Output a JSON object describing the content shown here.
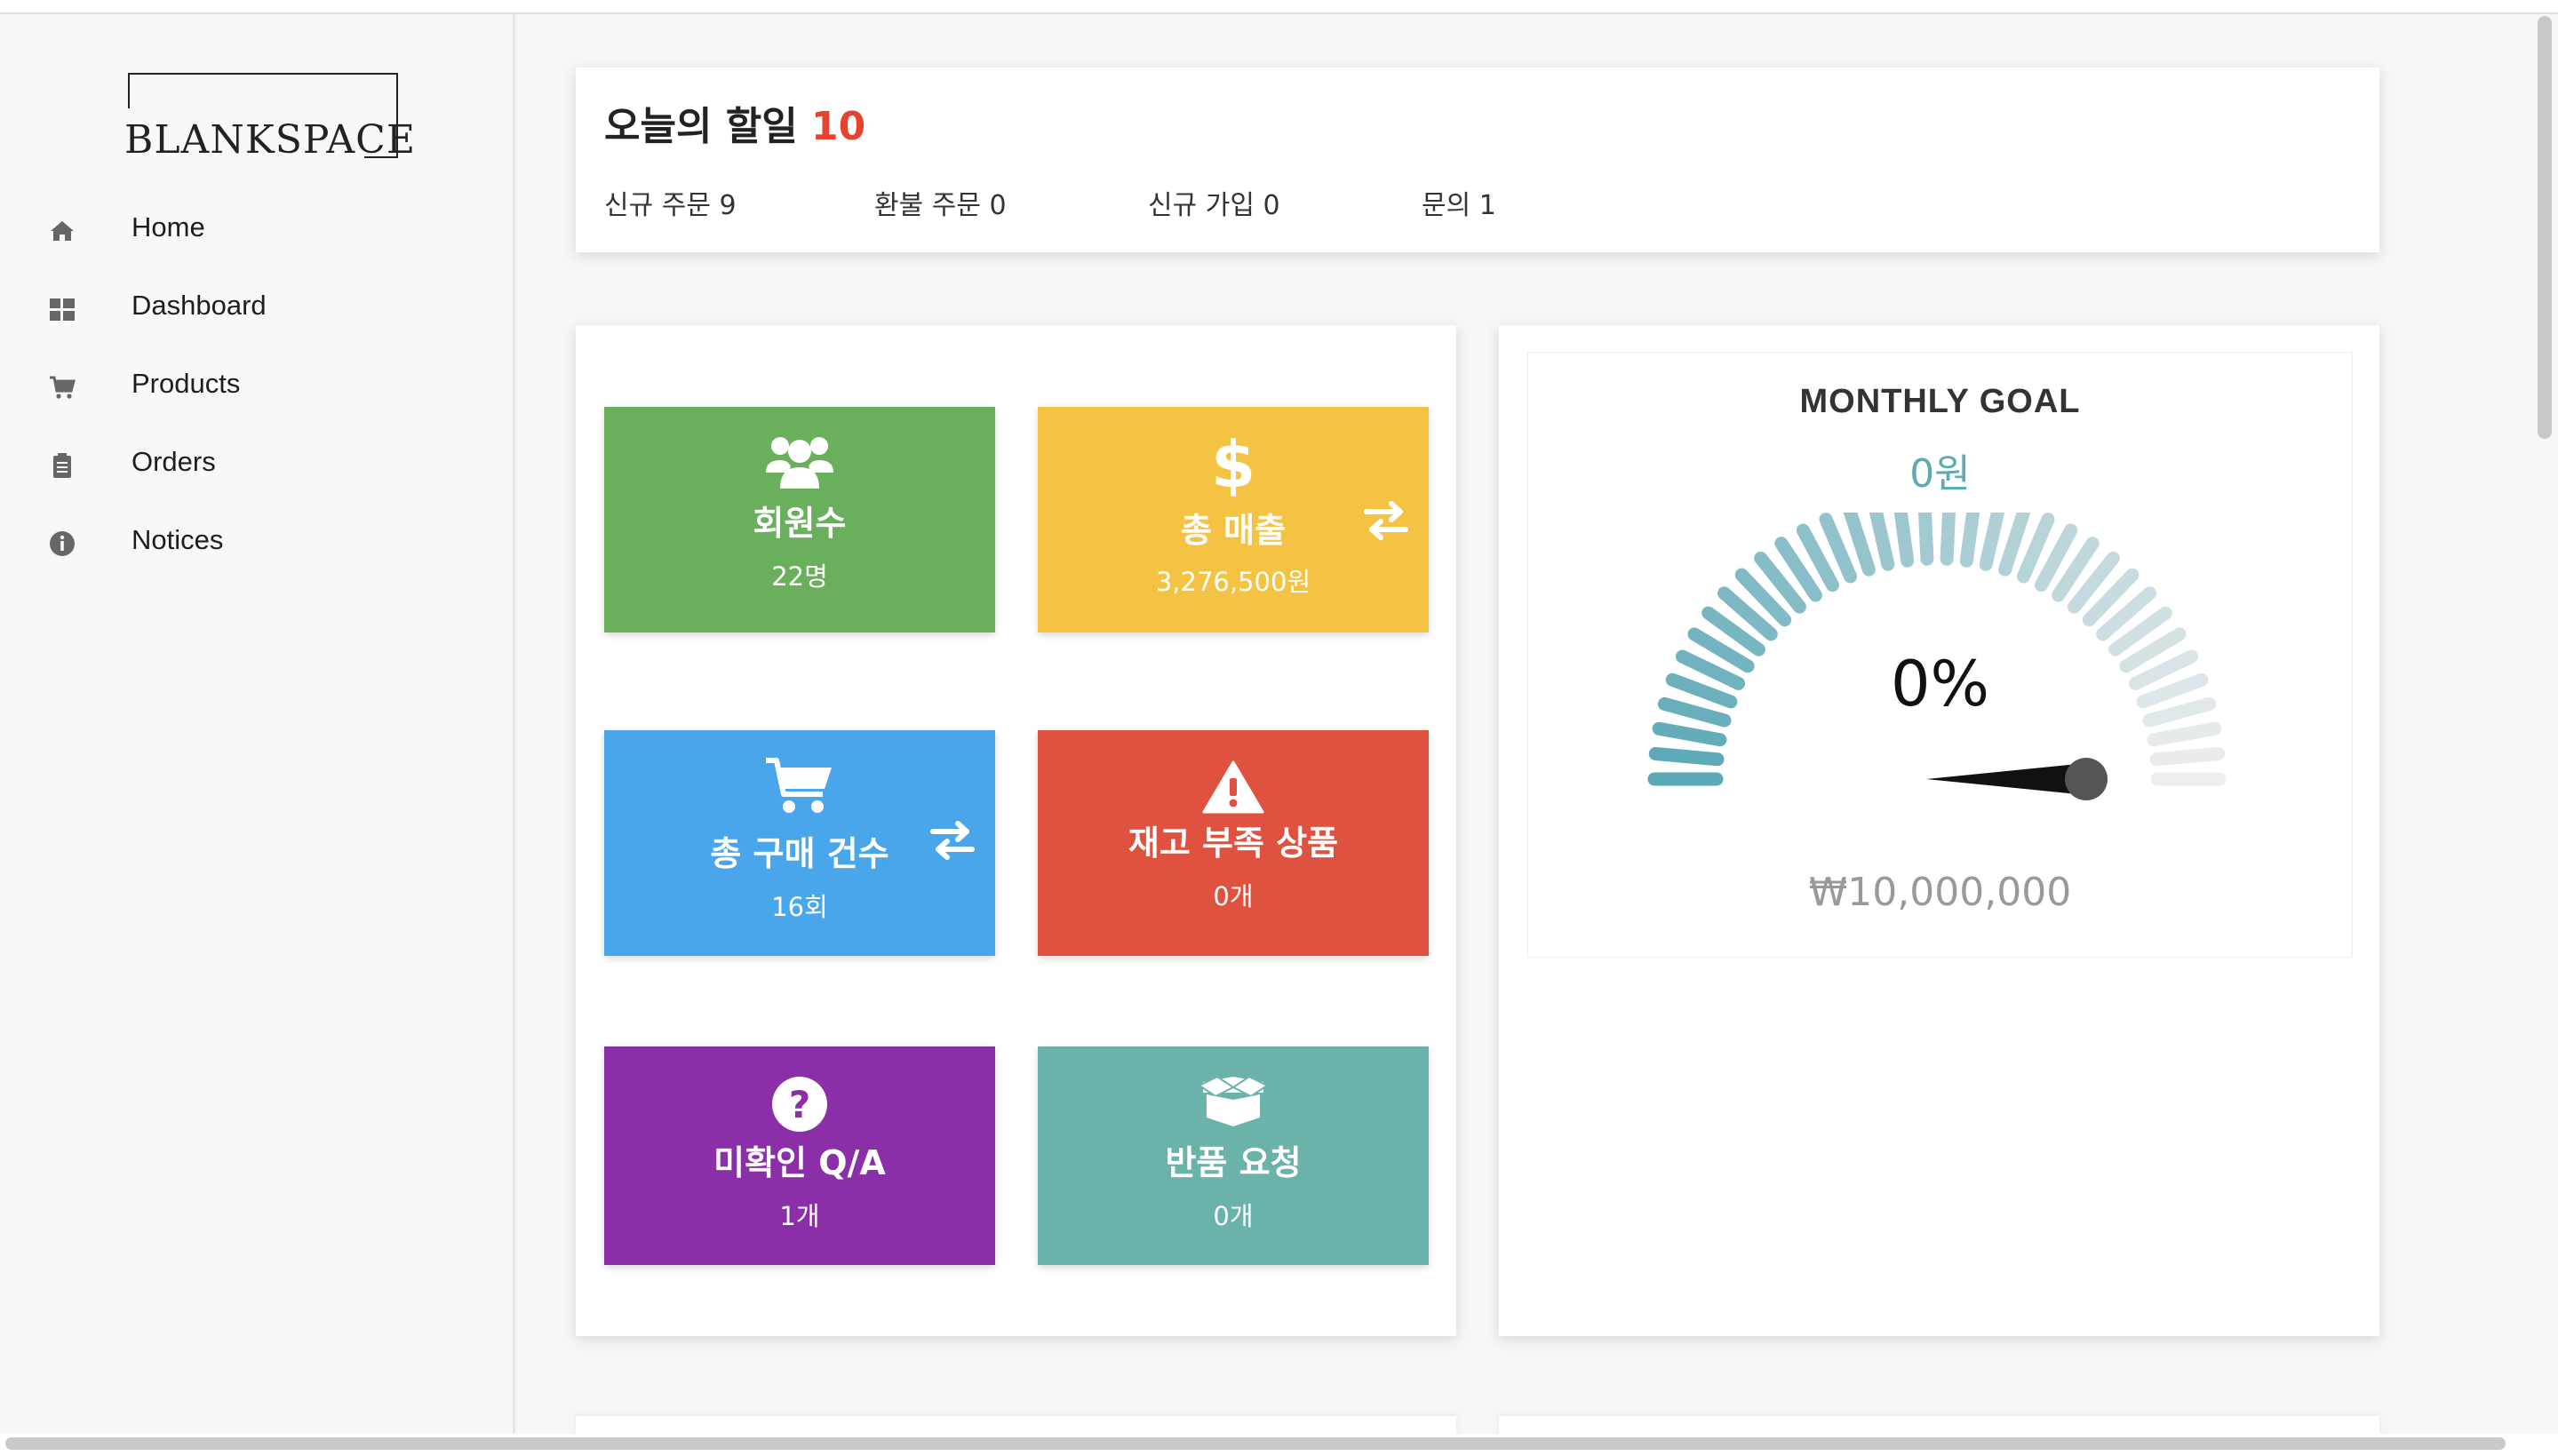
{
  "logo": {
    "text": "BLANKSPACE"
  },
  "nav": {
    "items": [
      {
        "label": "Home",
        "icon": "home-icon"
      },
      {
        "label": "Dashboard",
        "icon": "grid-icon"
      },
      {
        "label": "Products",
        "icon": "cart-icon"
      },
      {
        "label": "Orders",
        "icon": "clipboard-icon"
      },
      {
        "label": "Notices",
        "icon": "info-icon"
      }
    ]
  },
  "todo": {
    "title": "오늘의 할일",
    "count": "10",
    "stats": [
      "신규 주문 9",
      "환불 주문 0",
      "신규 가입 0",
      "문의 1"
    ]
  },
  "tiles": [
    {
      "title": "회원수",
      "value": "22명",
      "icon": "users-icon",
      "color": "#6aaf5b"
    },
    {
      "title": "총 매출",
      "value": "3,276,500원",
      "icon": "dollar-icon",
      "color": "#f5c344"
    },
    {
      "title": "총 구매 건수",
      "value": "16회",
      "icon": "cart-icon",
      "color": "#4aa6ea"
    },
    {
      "title": "재고 부족 상품",
      "value": "0개",
      "icon": "warning-icon",
      "color": "#e05240"
    },
    {
      "title": "미확인 Q/A",
      "value": "1개",
      "icon": "question-icon",
      "color": "#8b2fa8"
    },
    {
      "title": "반품 요청",
      "value": "0개",
      "icon": "box-icon",
      "color": "#6bb3aa"
    }
  ],
  "goal": {
    "title": "MONTHLY GOAL",
    "amount": "0원",
    "percent": "0%",
    "progress": 0,
    "target": "₩10,000,000",
    "gauge_colors": {
      "start": "#5ba8b6",
      "end": "#eeeeee",
      "needle": "#111111"
    }
  }
}
